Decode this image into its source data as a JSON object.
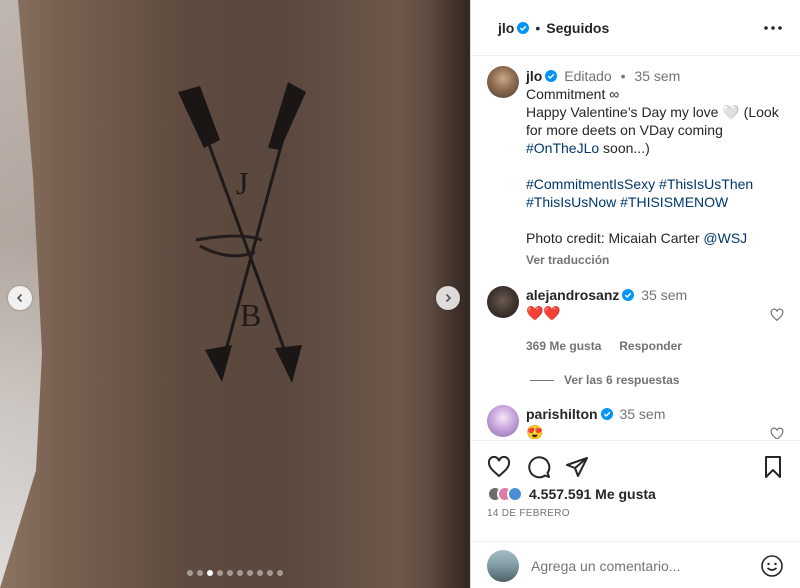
{
  "post": {
    "author": "jlo",
    "follow_status": "Seguidos",
    "edited": "Editado",
    "age": "35 sem",
    "caption_title": "Commitment ∞",
    "caption_line1": "Happy Valentine’s Day my love 🤍 (Look for more deets on VDay coming ",
    "caption_tag1": "#OnTheJLo",
    "caption_line1_end": " soon...)",
    "hashtags_1": "#CommitmentIsSexy #ThisIsUsThen",
    "hashtags_2": "#ThisIsUsNow #THISISMENOW",
    "credit_text": "Photo credit: Micaiah Carter ",
    "credit_tag": "@WSJ",
    "translate": "Ver traducción"
  },
  "comments": [
    {
      "user": "alejandrosanz",
      "age": "35 sem",
      "text": "❤️❤️",
      "likes": "369 Me gusta",
      "reply": "Responder",
      "view_replies": "Ver las 6 respuestas"
    },
    {
      "user": "parishilton",
      "age": "35 sem",
      "text": "😍"
    }
  ],
  "stats": {
    "likes": "4.557.591 Me gusta",
    "date": "14 DE FEBRERO"
  },
  "comment_box": {
    "placeholder": "Agrega un comentario..."
  },
  "carousel": {
    "slide_count": 10,
    "active_index": 2
  },
  "image_tattoo": {
    "letter_top": "J",
    "letter_bottom": "B"
  },
  "colors": {
    "verified": "#0095f6",
    "hashtag": "#00376b",
    "heart": "#ed4956"
  }
}
